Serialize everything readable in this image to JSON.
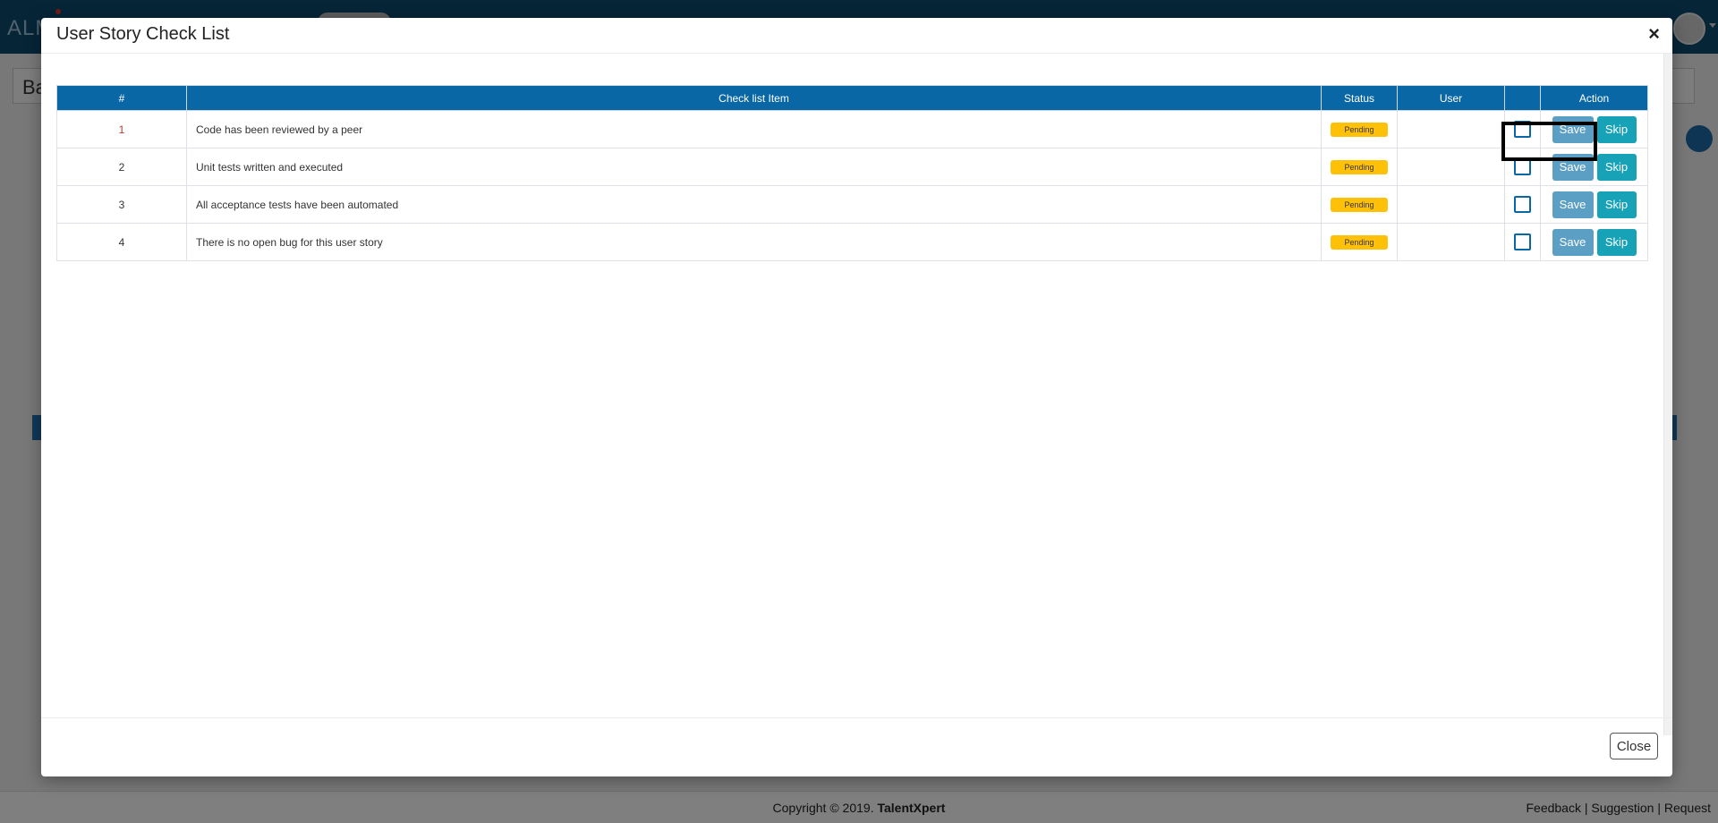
{
  "background": {
    "brand": "ALM",
    "panel_title": "Ba",
    "footer": {
      "copyright": "Copyright © 2019.",
      "company": "TalentXpert",
      "links": "Feedback | Suggestion | Request"
    }
  },
  "modal": {
    "title": "User Story Check List",
    "close_symbol": "×",
    "close_button": "Close",
    "table": {
      "headers": [
        "#",
        "Check list Item",
        "Status",
        "User",
        "",
        "Action"
      ],
      "rows": [
        {
          "num": "1",
          "item": "Code has been reviewed by a peer",
          "status": "Pending",
          "user": "",
          "save": "Save",
          "skip": "Skip"
        },
        {
          "num": "2",
          "item": "Unit tests written and executed",
          "status": "Pending",
          "user": "",
          "save": "Save",
          "skip": "Skip"
        },
        {
          "num": "3",
          "item": "All acceptance tests have been automated",
          "status": "Pending",
          "user": "",
          "save": "Save",
          "skip": "Skip"
        },
        {
          "num": "4",
          "item": "There is no open bug for this user story",
          "status": "Pending",
          "user": "",
          "save": "Save",
          "skip": "Skip"
        }
      ]
    }
  },
  "colors": {
    "header_blue": "#0a67a6",
    "pending_badge": "#ffc107",
    "save_button": "#5c9fc4",
    "skip_button": "#17a2b8"
  }
}
